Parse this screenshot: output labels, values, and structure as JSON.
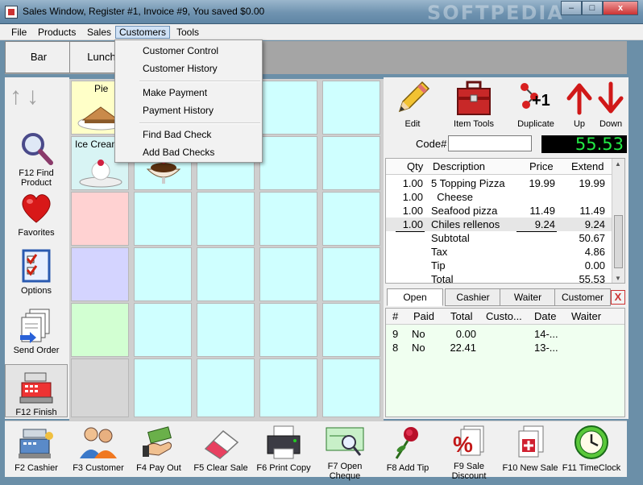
{
  "window": {
    "title": "Sales Window,  Register #1,  Invoice #9, You saved $0.00",
    "watermark": "SOFTPEDIA",
    "minimize": "–",
    "maximize": "□",
    "close": "x"
  },
  "menu": {
    "items": [
      "File",
      "Products",
      "Sales",
      "Customers",
      "Tools"
    ],
    "active": "Customers"
  },
  "customers_menu": {
    "items": [
      "Customer Control",
      "Customer History",
      "Make Payment",
      "Payment History",
      "Find Bad Check",
      "Add Bad Checks"
    ]
  },
  "categories": [
    "Bar",
    "Lunch"
  ],
  "left_tools": [
    {
      "label": "F12 Find Product",
      "icon": "magnifier-icon"
    },
    {
      "label": "Favorites",
      "icon": "heart-icon"
    },
    {
      "label": "Options",
      "icon": "checklist-icon"
    },
    {
      "label": "Send Order",
      "icon": "documents-icon"
    },
    {
      "label": "F12 Finish",
      "icon": "cash-register-icon"
    }
  ],
  "arrows": {
    "up": "↑",
    "down": "↓"
  },
  "products": [
    {
      "label": "Pie",
      "icon": "pie-icon"
    },
    {
      "label": "Ice Cream",
      "icon": "ice-cream-icon"
    },
    {
      "label": "",
      "icon": "sundae-icon"
    }
  ],
  "right_tools": [
    {
      "label": "Edit",
      "icon": "pencil-icon"
    },
    {
      "label": "Item Tools",
      "icon": "toolbox-icon"
    },
    {
      "label": "Duplicate",
      "icon": "duplicate-icon"
    },
    {
      "label": "Up",
      "icon": "up-arrow-icon"
    },
    {
      "label": "Down",
      "icon": "down-arrow-icon"
    }
  ],
  "duplicate_badge": "+1",
  "code": {
    "label": "Code#",
    "value": ""
  },
  "total_display": "55.53",
  "receipt": {
    "headers": {
      "qty": "Qty",
      "description": "Description",
      "price": "Price",
      "extend": "Extend"
    },
    "rows": [
      {
        "qty": "1.00",
        "description": "5 Topping Pizza",
        "price": "19.99",
        "extend": "19.99"
      },
      {
        "qty": "1.00",
        "description": "  Cheese",
        "price": "",
        "extend": ""
      },
      {
        "qty": "1.00",
        "description": "Seafood pizza",
        "price": "11.49",
        "extend": "11.49"
      },
      {
        "qty": "1.00",
        "description": "Chiles rellenos",
        "price": "9.24",
        "extend": "9.24"
      }
    ],
    "summary": [
      {
        "label": "Subtotal",
        "value": "50.67"
      },
      {
        "label": "Tax",
        "value": "4.86"
      },
      {
        "label": "Tip",
        "value": "0.00"
      },
      {
        "label": "Total",
        "value": "55.53"
      }
    ]
  },
  "check_tabs": [
    "Open",
    "Cashier",
    "Waiter",
    "Customer"
  ],
  "check_tab_close": "X",
  "checks": {
    "headers": {
      "num": "#",
      "paid": "Paid",
      "total": "Total",
      "customer": "Custo...",
      "date": "Date",
      "waiter": "Waiter"
    },
    "rows": [
      {
        "num": "9",
        "paid": "No",
        "total": "0.00",
        "customer": "",
        "date": "14-...",
        "waiter": ""
      },
      {
        "num": "8",
        "paid": "No",
        "total": "22.41",
        "customer": "",
        "date": "13-...",
        "waiter": ""
      }
    ]
  },
  "bottom_tools": [
    {
      "label": "F2 Cashier",
      "icon": "cashier-icon"
    },
    {
      "label": "F3 Customer",
      "icon": "customer-icon"
    },
    {
      "label": "F4 Pay Out",
      "icon": "money-icon"
    },
    {
      "label": "F5 Clear Sale",
      "icon": "eraser-icon"
    },
    {
      "label": "F6 Print Copy",
      "icon": "printer-icon"
    },
    {
      "label": "F7 Open Cheque",
      "icon": "cheque-icon"
    },
    {
      "label": "F8 Add Tip",
      "icon": "rose-icon"
    },
    {
      "label": "F9 Sale Discount",
      "icon": "percent-icon"
    },
    {
      "label": "F10 New Sale",
      "icon": "new-sale-icon"
    },
    {
      "label": "F11 TimeClock",
      "icon": "clock-icon"
    }
  ],
  "colors": {
    "total_digits": "#22e844",
    "grid_cell": "#cfffff",
    "accent_red": "#d01818"
  }
}
